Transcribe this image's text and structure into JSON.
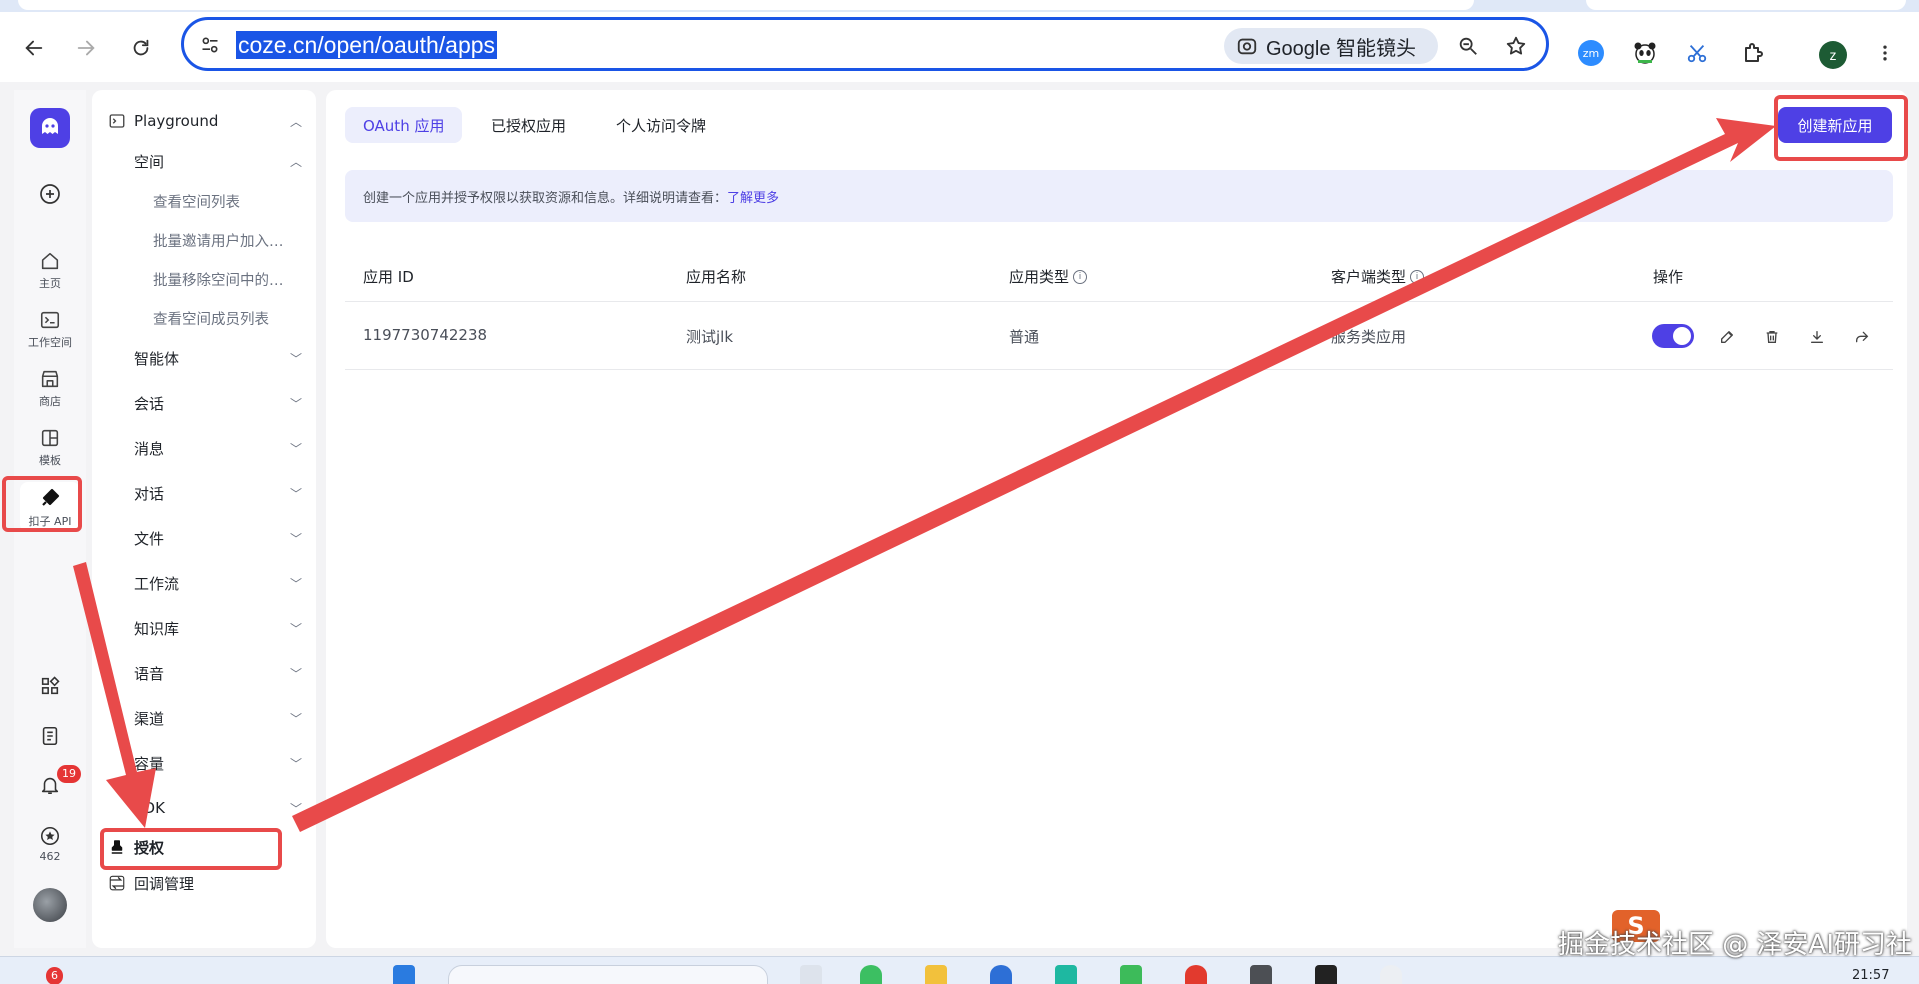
{
  "browser": {
    "url": "coze.cn/open/oauth/apps",
    "lens_label": "Google 智能镜头",
    "profile_initial": "z",
    "ext_zm_label": "zm"
  },
  "rail": {
    "items": [
      {
        "icon": "home-icon",
        "label": "主页"
      },
      {
        "icon": "terminal-icon",
        "label": "工作空间"
      },
      {
        "icon": "store-icon",
        "label": "商店"
      },
      {
        "icon": "template-icon",
        "label": "模板"
      },
      {
        "icon": "api-plug-icon",
        "label": "扣子 API"
      }
    ],
    "notification_count": "19",
    "star_count": "462"
  },
  "sidebar": {
    "playground": "Playground",
    "space": "空间",
    "space_children": [
      "查看空间列表",
      "批量邀请用户加入…",
      "批量移除空间中的…",
      "查看空间成员列表"
    ],
    "sections": [
      "智能体",
      "会话",
      "消息",
      "对话",
      "文件",
      "工作流",
      "知识库",
      "语音",
      "渠道",
      "容量",
      "SDK"
    ],
    "auth": "授权",
    "callback": "回调管理"
  },
  "main": {
    "tabs": [
      "OAuth 应用",
      "已授权应用",
      "个人访问令牌"
    ],
    "create_button": "创建新应用",
    "banner_text": "创建一个应用并授予权限以获取资源和信息。详细说明请查看：",
    "banner_link": "了解更多",
    "table": {
      "headers": [
        "应用 ID",
        "应用名称",
        "应用类型",
        "客户端类型",
        "操作"
      ],
      "rows": [
        {
          "id": "1197730742238",
          "name": "测试jlk",
          "type": "普通",
          "client_type": "服务类应用",
          "enabled": true
        }
      ]
    }
  },
  "taskbar": {
    "time": "21:57",
    "badge": "6"
  },
  "watermark": "掘金技术社区 @ 泽安AI研习社",
  "colors": {
    "accent": "#4e40e5",
    "annotation": "#e84a4a",
    "omnibox_border": "#1a55e6"
  }
}
